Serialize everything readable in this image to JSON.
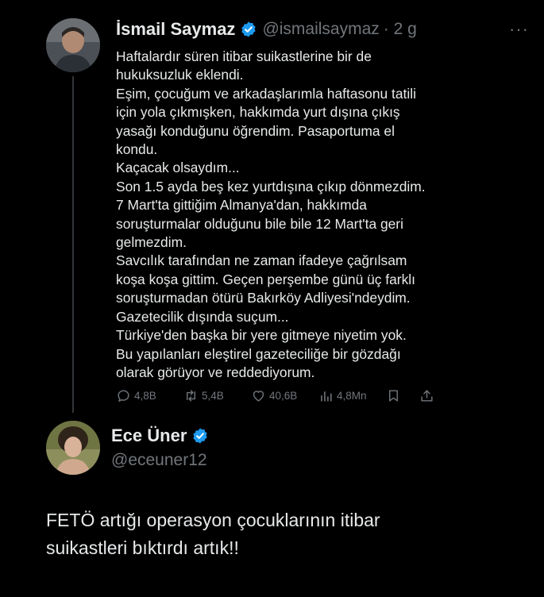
{
  "tweet": {
    "author_name": "İsmail Saymaz",
    "handle": "@ismailsaymaz",
    "time": "· 2 g",
    "more": "···",
    "lines": [
      "Haftalardır süren itibar suikastlerine bir de",
      "hukuksuzluk eklendi.",
      "Eşim, çocuğum ve arkadaşlarımla haftasonu tatili",
      "için yola çıkmışken, hakkımda yurt dışına çıkış",
      "yasağı konduğunu öğrendim. Pasaportuma el",
      "kondu.",
      "Kaçacak olsaydım...",
      "Son 1.5 ayda beş kez yurtdışına çıkıp dönmezdim.",
      "7 Mart'ta gittiğim Almanya'dan, hakkımda",
      "soruşturmalar olduğunu bile bile 12 Mart'ta geri",
      "gelmezdim.",
      "Savcılık tarafından ne zaman ifadeye çağrılsam",
      "koşa koşa gittim. Geçen perşembe günü üç farklı",
      "soruşturmadan ötürü Bakırköy Adliyesi'ndeydim.",
      "Gazetecilik dışında suçum...",
      "Türkiye'den başka bir yere gitmeye niyetim yok.",
      "Bu yapılanları eleştirel gazeteciliğe bir gözdağı",
      "olarak görüyor ve reddediyorum."
    ],
    "stats": {
      "replies": "4,8B",
      "retweets": "5,4B",
      "likes": "40,6B",
      "views": "4,8Mn"
    }
  },
  "reply": {
    "author_name": "Ece Üner",
    "handle": "@eceuner12",
    "lines": [
      "FETÖ artığı operasyon çocuklarının itibar",
      "suikastleri bıktırdı artık!!"
    ]
  },
  "colors": {
    "background": "#000000",
    "text": "#e7e9ea",
    "secondary": "#71767b",
    "verified": "#1d9bf0"
  }
}
